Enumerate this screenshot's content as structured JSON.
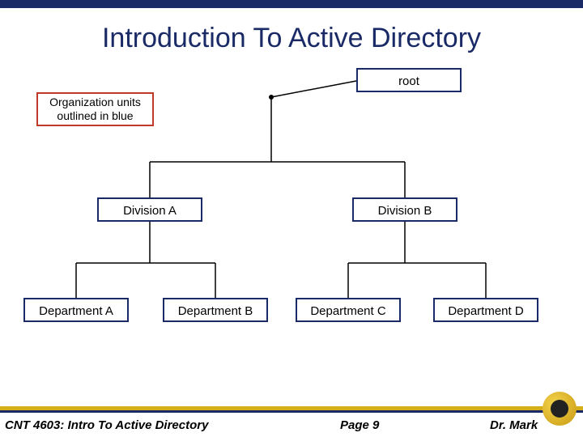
{
  "title": "Introduction To Active Directory",
  "legend": "Organization units outlined in blue",
  "nodes": {
    "root": "root",
    "divA": "Division A",
    "divB": "Division B",
    "depA": "Department A",
    "depB": "Department B",
    "depC": "Department C",
    "depD": "Department D"
  },
  "footer": {
    "course": "CNT 4603: Intro To Active Directory",
    "page": "Page 9",
    "author": "Dr. Mark"
  },
  "chart_data": {
    "type": "tree",
    "title": "Introduction To Active Directory",
    "legend": "Organization units outlined in blue",
    "root": {
      "label": "root",
      "children": [
        {
          "label": "Division A",
          "children": [
            {
              "label": "Department A"
            },
            {
              "label": "Department B"
            }
          ]
        },
        {
          "label": "Division B",
          "children": [
            {
              "label": "Department C"
            },
            {
              "label": "Department D"
            }
          ]
        }
      ]
    }
  }
}
